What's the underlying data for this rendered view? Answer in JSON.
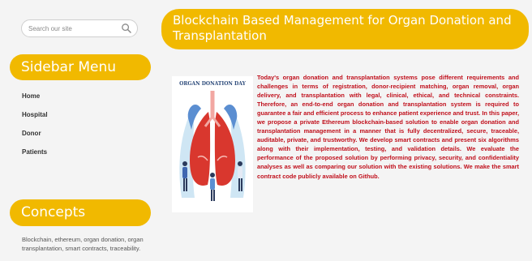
{
  "search": {
    "placeholder": "Search our site"
  },
  "sidebar": {
    "header": "Sidebar Menu",
    "items": [
      {
        "label": "Home"
      },
      {
        "label": "Hospital"
      },
      {
        "label": "Donor"
      },
      {
        "label": "Patients"
      }
    ]
  },
  "concepts": {
    "header": "Concepts",
    "text": "Blockchain, ethereum, organ donation, organ transplantation, smart contracts, traceability."
  },
  "main": {
    "title": "Blockchain Based Management for Organ Donation and Transplantation",
    "figure_caption": "ORGAN DONATION DAY",
    "abstract": "Today's organ donation and transplantation systems pose different requirements and challenges in terms of registration, donor-recipient matching, organ removal, organ delivery, and transplantation with legal, clinical, ethical, and technical constraints. Therefore, an end-to-end organ donation and transplantation system is required to guarantee a fair and efficient process to enhance patient experience and trust. In this paper, we propose a private Ethereum blockchain-based solution to enable organ donation and transplantation management in a manner that is fully decentralized, secure, traceable, auditable, private, and trustworthy. We develop smart contracts and present six algorithms along with their implementation, testing, and validation details. We evaluate the performance of the proposed solution by performing privacy, security, and confidentiality analyses as well as comparing our solution with the existing solutions. We make the smart contract code publicly available on Github."
  },
  "colors": {
    "accent": "#f1b900",
    "abstract_text": "#c0101c",
    "background": "#f4f4f4"
  },
  "icons": [
    "search-icon",
    "lungs-illustration"
  ]
}
